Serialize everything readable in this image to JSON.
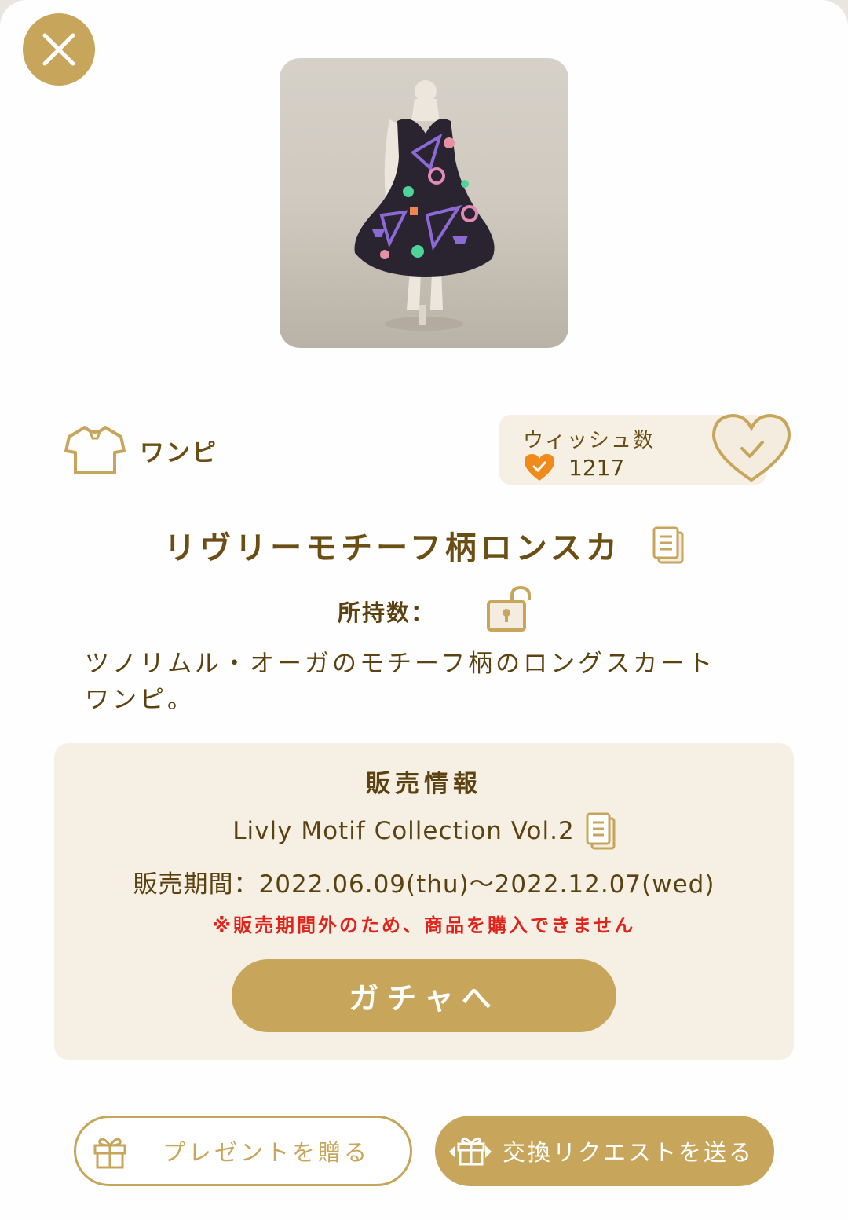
{
  "item": {
    "category": "ワンピ",
    "title": "リヴリーモチーフ柄ロンスカ",
    "owned_label": "所持数：",
    "description_line1": "ツノリムル・オーガのモチーフ柄のロングスカート",
    "description_line2": "ワンピ。",
    "image_icon": "dress-icon"
  },
  "wish": {
    "label": "ウィッシュ数",
    "count": "1217"
  },
  "sale": {
    "heading": "販売情報",
    "collection": "Livly Motif Collection Vol.2",
    "period": "販売期間：2022.06.09(thu)〜2022.12.07(wed)",
    "warning": "※販売期間外のため、商品を購入できません",
    "gacha_button": "ガチャへ"
  },
  "actions": {
    "present_button": "プレゼントを贈る",
    "trade_button": "交換リクエストを送る"
  },
  "colors": {
    "gold": "#c7a65b",
    "brown_text": "#5c4210",
    "panel_bg": "#f6efe3",
    "warning_red": "#e0231b",
    "wish_heart": "#f08a1a"
  }
}
